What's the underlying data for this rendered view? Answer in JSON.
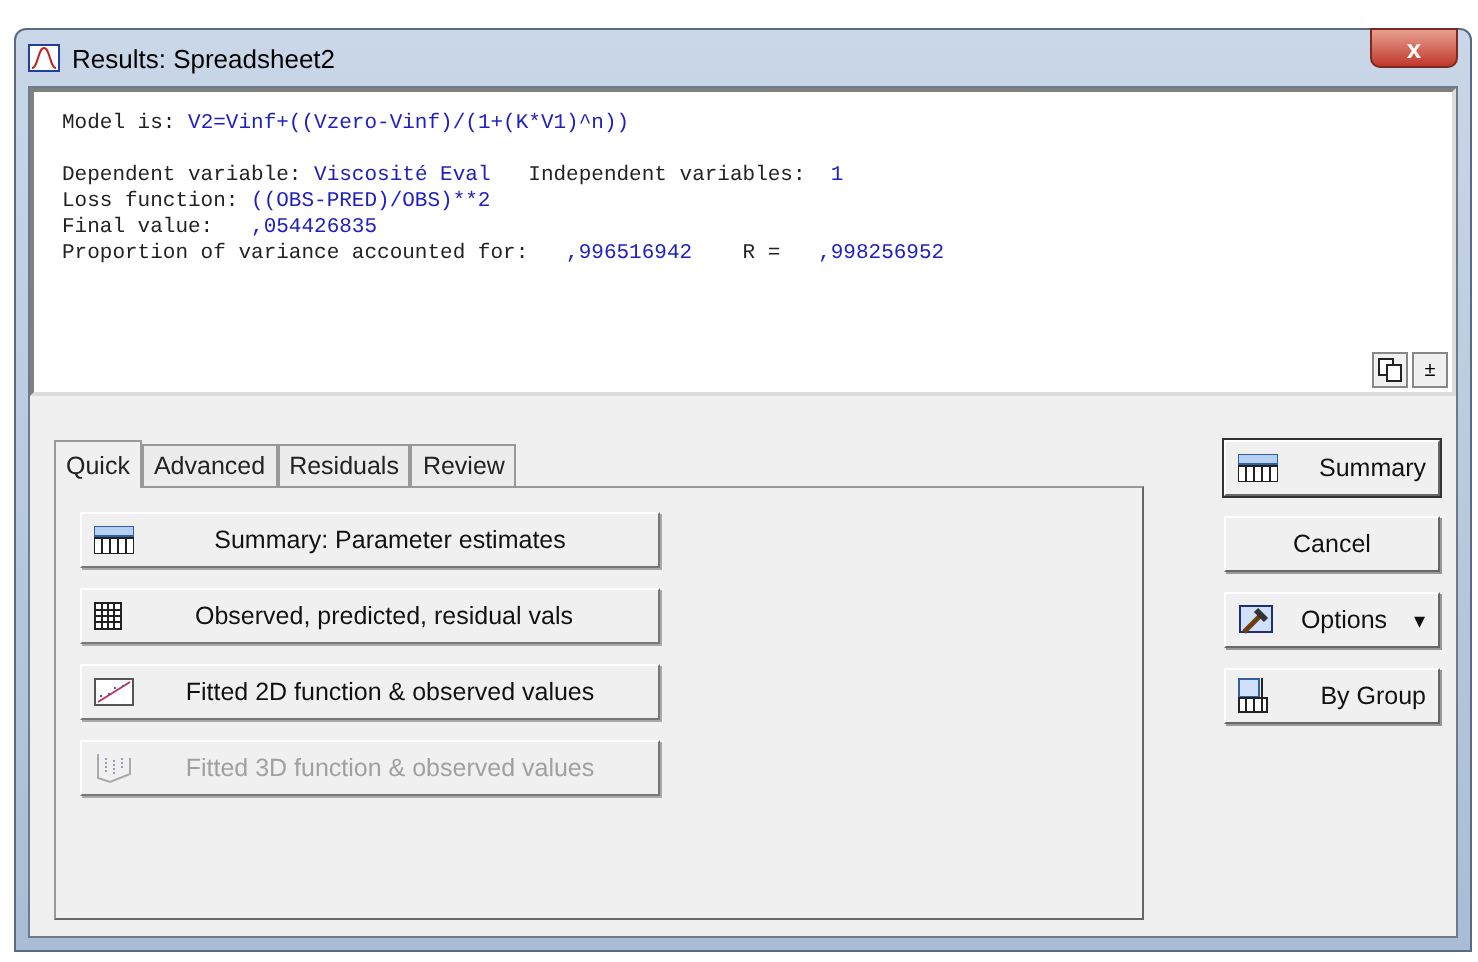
{
  "window": {
    "title": "Results: Spreadsheet2",
    "close": "x"
  },
  "output": {
    "lines": [
      [
        {
          "kind": "label",
          "text": "Model is: "
        },
        {
          "kind": "value",
          "text": "V2=Vinf+((Vzero-Vinf)/(1+(K*V1)^n))"
        }
      ],
      [
        {
          "kind": "label",
          "text": "Dependent variable: "
        },
        {
          "kind": "value",
          "text": "Viscosité Eval"
        },
        {
          "kind": "label",
          "text": "   Independent variables:  "
        },
        {
          "kind": "value",
          "text": "1"
        }
      ],
      [
        {
          "kind": "label",
          "text": "Loss function: "
        },
        {
          "kind": "value",
          "text": "((OBS-PRED)/OBS)**2"
        }
      ],
      [
        {
          "kind": "label",
          "text": "Final value:   "
        },
        {
          "kind": "value",
          "text": ",054426835"
        }
      ],
      [
        {
          "kind": "label",
          "text": "Proportion of variance accounted for:   "
        },
        {
          "kind": "value",
          "text": ",996516942"
        },
        {
          "kind": "label",
          "text": "    R =   "
        },
        {
          "kind": "value",
          "text": ",998256952"
        }
      ]
    ],
    "collapse": "±"
  },
  "tabs": [
    {
      "label": "Quick",
      "selected": true
    },
    {
      "label": "Advanced",
      "selected": false
    },
    {
      "label": "Residuals",
      "selected": false
    },
    {
      "label": "Review",
      "selected": false
    }
  ],
  "actions": [
    {
      "kind": "summary",
      "label": "Summary: Parameter estimates",
      "disabled": false
    },
    {
      "kind": "table",
      "label": "Observed, predicted, residual vals",
      "disabled": false
    },
    {
      "kind": "plot2d",
      "label": "Fitted 2D function & observed values",
      "disabled": false
    },
    {
      "kind": "plot3d",
      "label": "Fitted 3D function & observed values",
      "disabled": true
    }
  ],
  "side_buttons": [
    {
      "kind": "summary",
      "label": "Summary"
    },
    {
      "kind": "cancel",
      "label": "Cancel"
    },
    {
      "kind": "options",
      "label": "Options",
      "caret": "▾"
    },
    {
      "kind": "bygroup",
      "label": "By Group"
    }
  ]
}
